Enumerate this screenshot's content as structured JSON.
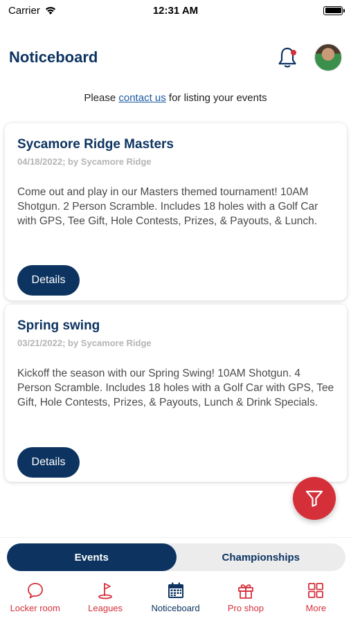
{
  "status_bar": {
    "carrier": "Carrier",
    "time": "12:31 AM"
  },
  "header": {
    "title": "Noticeboard"
  },
  "contact": {
    "prefix": "Please ",
    "link": "contact us",
    "suffix": " for listing your events"
  },
  "cards": [
    {
      "title": "Sycamore Ridge Masters",
      "meta": "04/18/2022; by Sycamore Ridge",
      "body": "Come out and play in our Masters themed tournament! 10AM Shotgun. 2 Person Scramble. Includes 18 holes with a Golf Car with GPS, Tee Gift, Hole Contests, Prizes, & Payouts, & Lunch.",
      "button": "Details"
    },
    {
      "title": "Spring swing",
      "meta": "03/21/2022; by Sycamore Ridge",
      "body": "Kickoff the season with our Spring Swing! 10AM Shotgun. 4 Person Scramble. Includes 18 holes with a Golf Car with GPS, Tee Gift, Hole Contests, Prizes, & Payouts, Lunch & Drink Specials.",
      "button": "Details"
    }
  ],
  "segments": {
    "events": "Events",
    "championships": "Championships",
    "selected": "Events"
  },
  "tabs": [
    {
      "label": "Locker room",
      "icon": "chat-bubble-icon"
    },
    {
      "label": "Leagues",
      "icon": "golf-flag-icon"
    },
    {
      "label": "Noticeboard",
      "icon": "calendar-icon",
      "active": true
    },
    {
      "label": "Pro shop",
      "icon": "gift-icon"
    },
    {
      "label": "More",
      "icon": "grid-icon"
    }
  ],
  "colors": {
    "brand_navy": "#0d3461",
    "accent_red": "#d5303a"
  }
}
